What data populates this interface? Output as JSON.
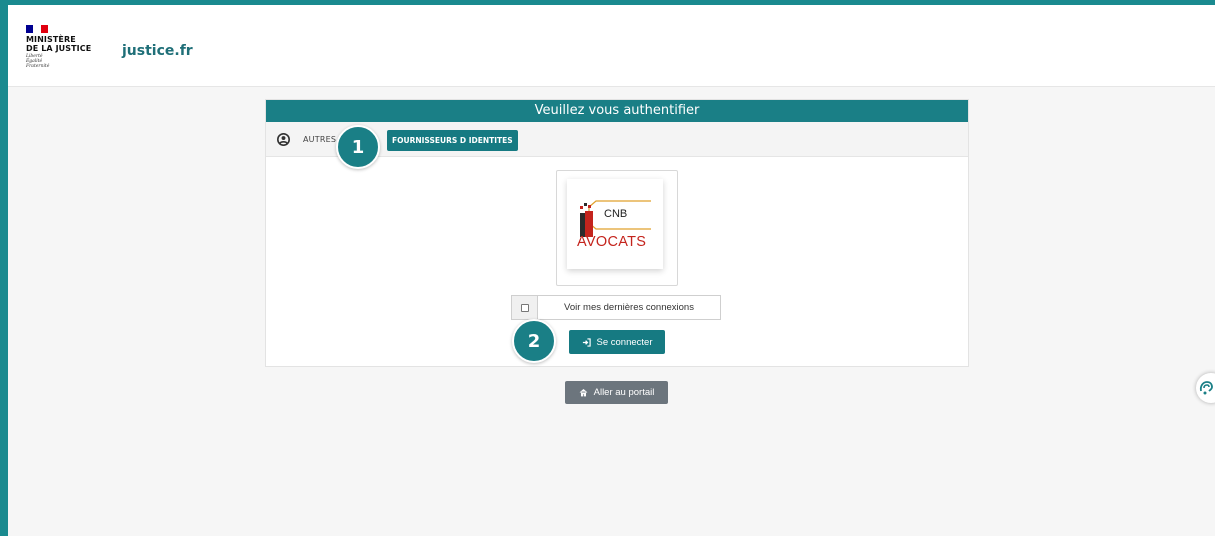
{
  "header": {
    "logo": {
      "flag_colors": [
        "#000091",
        "#ffffff",
        "#e1000f"
      ],
      "ministry_line1": "MINISTÈRE",
      "ministry_line2": "DE LA JUSTICE",
      "motto": [
        "Liberté",
        "Égalité",
        "Fraternité"
      ]
    },
    "site_name": "justice.fr"
  },
  "auth": {
    "title": "Veuillez vous authentifier",
    "tabs": [
      {
        "label": "AUTRES",
        "icon": "user-circle-icon",
        "active": false
      },
      {
        "label": "FOURNISSEURS D IDENTITES",
        "active": true
      }
    ],
    "provider": {
      "logo_top_text": "CNB",
      "logo_bottom_text": "AVOCATS",
      "logo_colors": [
        "#c4241d",
        "#2b2b2b",
        "#e0a12c"
      ]
    },
    "remember": {
      "label": "Voir mes dernières connexions",
      "checked": false
    },
    "connect_button": {
      "label": "Se connecter",
      "icon": "sign-in-icon"
    }
  },
  "portal_button": {
    "label": "Aller au portail",
    "icon": "home-icon"
  },
  "step_badges": [
    "1",
    "2"
  ],
  "colors": {
    "accent": "#1a7f86",
    "frame": "#1a8a8f",
    "portal_button": "#6c757d",
    "background": "#f6f6f6"
  },
  "floating_widget": {
    "icon": "accessibility-icon"
  }
}
